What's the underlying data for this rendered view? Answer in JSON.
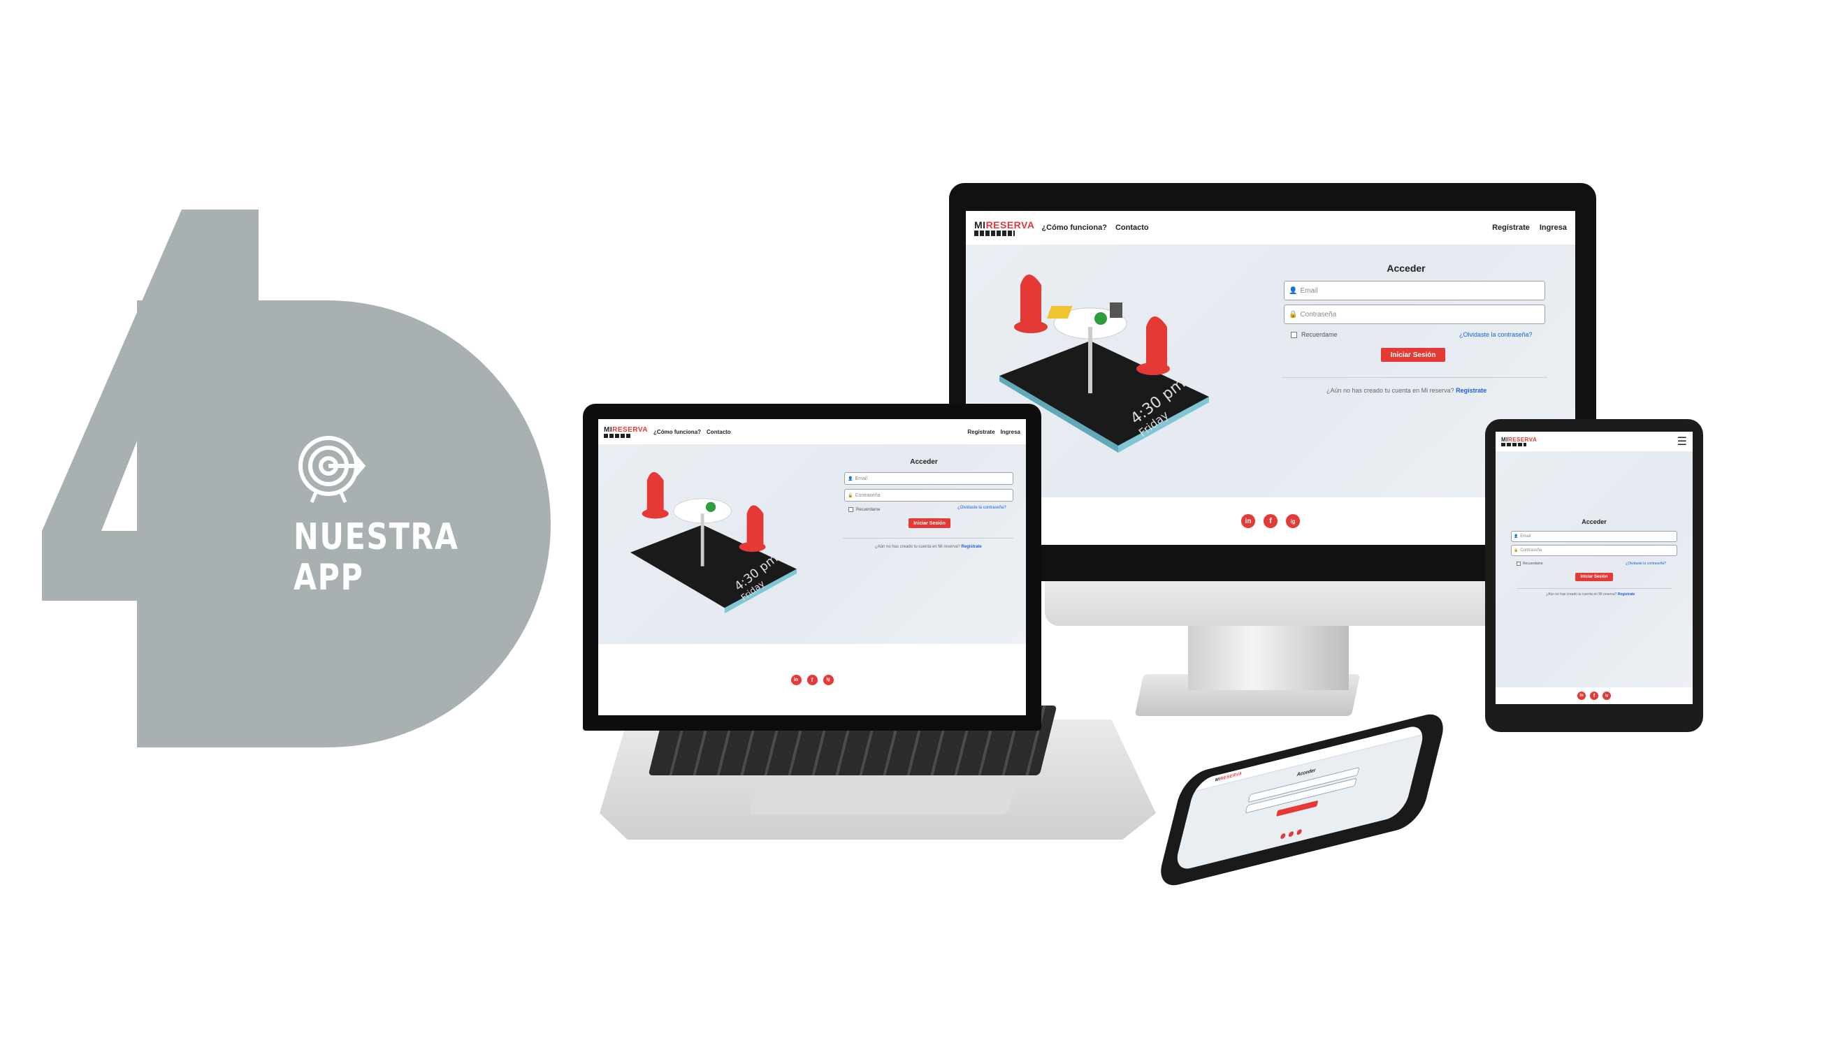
{
  "badge": {
    "number": "4",
    "title_line1": "NUESTRA",
    "title_line2": "APP",
    "icon": "target-icon"
  },
  "app": {
    "logo_prefix": "MI",
    "logo_suffix": "RESERVA",
    "nav_how": "¿Cómo funciona?",
    "nav_contact": "Contacto",
    "nav_register": "Regístrate",
    "nav_login": "Ingresa",
    "form_title": "Acceder",
    "email_placeholder": "Email",
    "password_placeholder": "Contraseña",
    "remember": "Recuerdame",
    "forgot": "¿Olvidaste la contraseña?",
    "login_button": "Iniciar Sesión",
    "signup_prefix": "¿Aún no has creado tu cuenta en Mi reserva?",
    "signup_link": "Regístrate",
    "illustration_time": "4:30 pm",
    "illustration_day": "Friday",
    "social": [
      "in",
      "f",
      "ig"
    ],
    "accent_color": "#e53935",
    "link_color": "#1e5fd8"
  }
}
